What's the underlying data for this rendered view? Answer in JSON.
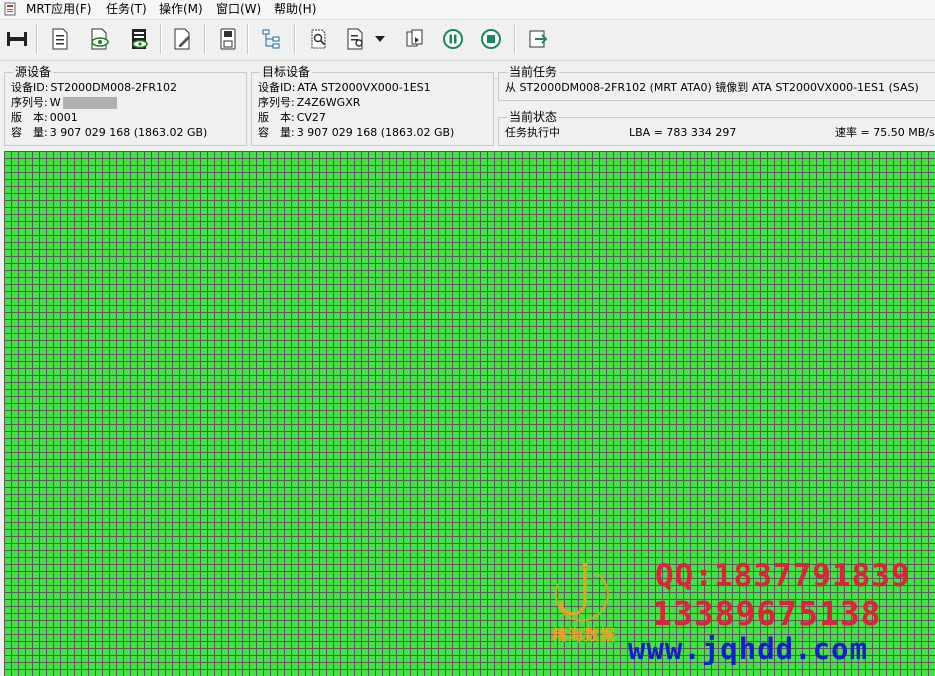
{
  "menu": {
    "items": [
      "MRT应用(F)",
      "任务(T)",
      "操作(M)",
      "窗口(W)",
      "帮助(H)"
    ]
  },
  "toolbar": {
    "buttons": [
      "connect-icon",
      "document-list-icon",
      "view-eye-icon",
      "log-view-icon",
      "edit-icon",
      "save-icon",
      "tree-icon",
      "search-doc-icon",
      "doc-find-icon",
      "dropdown-arrow-icon",
      "copy-icon",
      "pause-icon",
      "stop-icon",
      "exit-icon"
    ]
  },
  "source": {
    "title": "源设备",
    "device_id_label": "设备ID:",
    "device_id": "ST2000DM008-2FR102",
    "serial_label": "序列号:",
    "serial_prefix": "W",
    "version_label": "版　本:",
    "version": "0001",
    "capacity_label": "容　量:",
    "capacity": "3 907 029 168 (1863.02 GB)"
  },
  "target": {
    "title": "目标设备",
    "device_id_label": "设备ID:",
    "device_id": "ATA ST2000VX000-1ES1",
    "serial_label": "序列号:",
    "serial": "Z4Z6WGXR",
    "version_label": "版　本:",
    "version": "CV27",
    "capacity_label": "容　量:",
    "capacity": "3 907 029 168 (1863.02 GB)"
  },
  "task": {
    "title": "当前任务",
    "description": "从 ST2000DM008-2FR102 (MRT ATA0) 镜像到 ATA ST2000VX000-1ES1 (SAS)"
  },
  "status": {
    "title": "当前状态",
    "state": "任务执行中",
    "lba": "LBA = 783 334 297",
    "rate": "速率 = 75.50 MB/s"
  },
  "watermark": {
    "brand": "精海数据",
    "qq": "QQ:1837791839",
    "phone": "13389675138",
    "url": "www.jqhdd.com"
  },
  "colors": {
    "sector_ok": "#44e244",
    "grid_line": "#5a5a5a",
    "wm_red": "#e0203c",
    "wm_blue": "#1a1ad0",
    "wm_orange": "#f0a020"
  }
}
